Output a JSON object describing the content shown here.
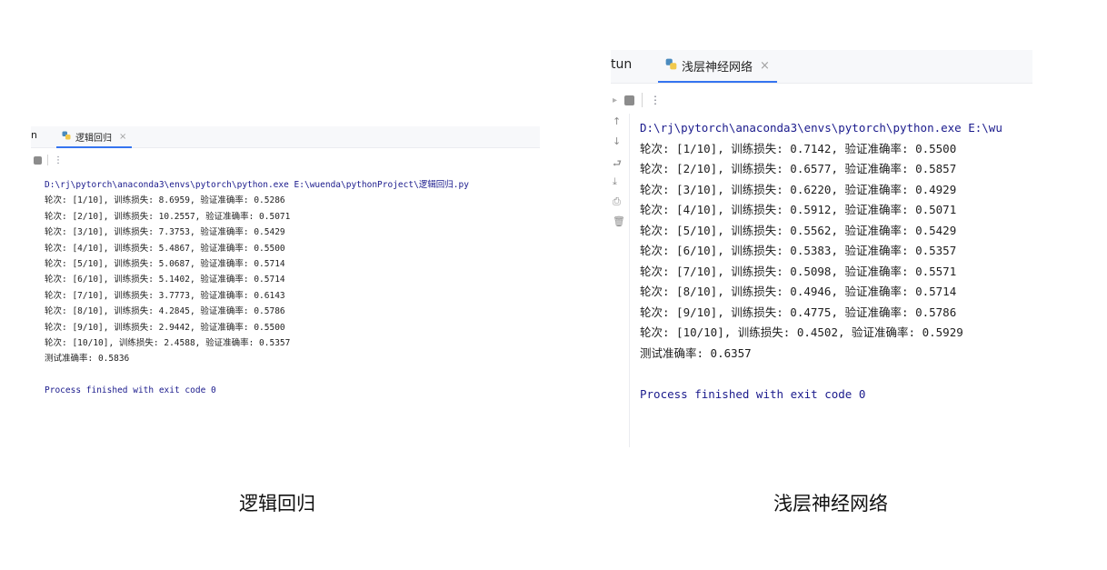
{
  "left": {
    "tab_stub": "n",
    "tab_label": "逻辑回归",
    "close_glyph": "×",
    "more_glyph": "⋮",
    "console": {
      "command": "D:\\rj\\pytorch\\anaconda3\\envs\\pytorch\\python.exe E:\\wuenda\\pythonProject\\逻辑回归.py",
      "lines": [
        "轮次: [1/10], 训练损失: 8.6959, 验证准确率: 0.5286",
        "轮次: [2/10], 训练损失: 10.2557, 验证准确率: 0.5071",
        "轮次: [3/10], 训练损失: 7.3753, 验证准确率: 0.5429",
        "轮次: [4/10], 训练损失: 5.4867, 验证准确率: 0.5500",
        "轮次: [5/10], 训练损失: 5.0687, 验证准确率: 0.5714",
        "轮次: [6/10], 训练损失: 5.1402, 验证准确率: 0.5714",
        "轮次: [7/10], 训练损失: 3.7773, 验证准确率: 0.6143",
        "轮次: [8/10], 训练损失: 4.2845, 验证准确率: 0.5786",
        "轮次: [9/10], 训练损失: 2.9442, 验证准确率: 0.5500",
        "轮次: [10/10], 训练损失: 2.4588, 验证准确率: 0.5357"
      ],
      "test_accuracy": "测试准确率: 0.5836",
      "finish": "Process finished with exit code 0"
    },
    "caption": "逻辑回归"
  },
  "right": {
    "tab_stub": "tun",
    "tab_label": "浅层神经网络",
    "close_glyph": "×",
    "more_glyph": "⋮",
    "console": {
      "command": "D:\\rj\\pytorch\\anaconda3\\envs\\pytorch\\python.exe E:\\wu",
      "lines": [
        "轮次: [1/10], 训练损失: 0.7142, 验证准确率: 0.5500",
        "轮次: [2/10], 训练损失: 0.6577, 验证准确率: 0.5857",
        "轮次: [3/10], 训练损失: 0.6220, 验证准确率: 0.4929",
        "轮次: [4/10], 训练损失: 0.5912, 验证准确率: 0.5071",
        "轮次: [5/10], 训练损失: 0.5562, 验证准确率: 0.5429",
        "轮次: [6/10], 训练损失: 0.5383, 验证准确率: 0.5357",
        "轮次: [7/10], 训练损失: 0.5098, 验证准确率: 0.5571",
        "轮次: [8/10], 训练损失: 0.4946, 验证准确率: 0.5714",
        "轮次: [9/10], 训练损失: 0.4775, 验证准确率: 0.5786",
        "轮次: [10/10], 训练损失: 0.4502, 验证准确率: 0.5929"
      ],
      "test_accuracy": "测试准确率: 0.6357",
      "finish": "Process finished with exit code 0"
    },
    "caption": "浅层神经网络"
  }
}
